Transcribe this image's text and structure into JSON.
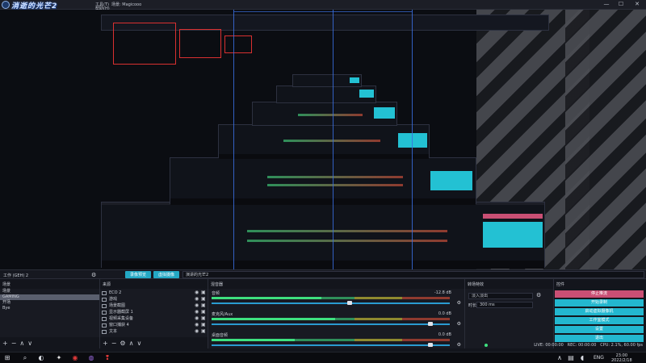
{
  "app": {
    "brand": "消逝的光芒2",
    "window_title": "场景: Magicooo",
    "menus": [
      "工具(T)",
      "帮助(H)"
    ],
    "controls": {
      "minimize": "—",
      "maximize": "☐",
      "close": "✕"
    }
  },
  "scene_bar": {
    "scene_name": "工作 (GEH) 2",
    "buttons": [
      "录像预览",
      "虚拟摄像"
    ],
    "input_text": "演讲的光芒2"
  },
  "scenes_dock": {
    "title": "场景",
    "items": [
      "场景",
      "GAMING",
      "开场",
      "Bye"
    ],
    "active_index": 1
  },
  "sources_dock": {
    "title": "来源",
    "items": [
      "ECO 2",
      "游戏",
      "场景截图",
      "显示器截屏 1",
      "视频采集设备",
      "窗口捕获 4",
      "文本"
    ]
  },
  "mixer_dock": {
    "title": "混音器",
    "channels": [
      {
        "name": "音频",
        "db": "-12.8 dB",
        "level": 0.46,
        "fader": 0.58
      },
      {
        "name": "麦克风/Aux",
        "db": "0.0 dB",
        "level": 0.52,
        "fader": 0.92
      },
      {
        "name": "桌面音频",
        "db": "0.0 dB",
        "level": 0.35,
        "fader": 0.92
      }
    ]
  },
  "transitions_dock": {
    "title": "转场特效",
    "transition": "淡入淡出",
    "duration_label": "时长",
    "duration": "300 ms"
  },
  "controls_dock": {
    "title": "控件",
    "buttons": [
      "停止推流",
      "开始录制",
      "启动虚拟摄像机",
      "工作室模式",
      "设置",
      "退出"
    ]
  },
  "status": {
    "live": "LIVE: 00:00:00",
    "rec": "REC: 00:00:00",
    "cpu": "CPU: 2.1%, 60.00 fps",
    "colors": {
      "live": "#3ee07f",
      "rec": "#d93030"
    }
  },
  "taskbar": {
    "icons": [
      "windows-icon",
      "search-icon",
      "steam-icon",
      "netease-icon",
      "obs-icon",
      "game-icon"
    ],
    "lang": "ENG",
    "time": "23:00",
    "date": "2022/2/18"
  },
  "colors": {
    "accent": "#23b7cf",
    "stop": "#c94f74",
    "preview_border": "#d93030"
  }
}
